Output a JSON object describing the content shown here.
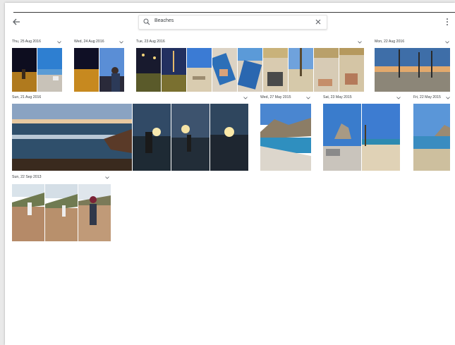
{
  "search": {
    "query": "Beaches"
  },
  "groups": [
    {
      "date": "Thu, 25 Aug 2016"
    },
    {
      "date": "Wed, 24 Aug 2016"
    },
    {
      "date": "Tue, 23 Aug 2016"
    },
    {
      "date": "Mon, 22 Aug 2016"
    },
    {
      "date": "Sun, 21 Aug 2016"
    },
    {
      "date": "Wed, 27 May 2015"
    },
    {
      "date": "Sat, 23 May 2015"
    },
    {
      "date": "Fri, 22 May 2015"
    },
    {
      "date": "Sun, 22 Sep 2013"
    }
  ],
  "icons": {
    "back": "arrow-back-icon",
    "search": "search-icon",
    "clear": "close-icon",
    "more": "more-vert-icon",
    "expand": "chevron-down-icon"
  },
  "colors": {
    "text": "#3c4043",
    "background": "#ffffff",
    "divider": "#3a3a3a"
  }
}
